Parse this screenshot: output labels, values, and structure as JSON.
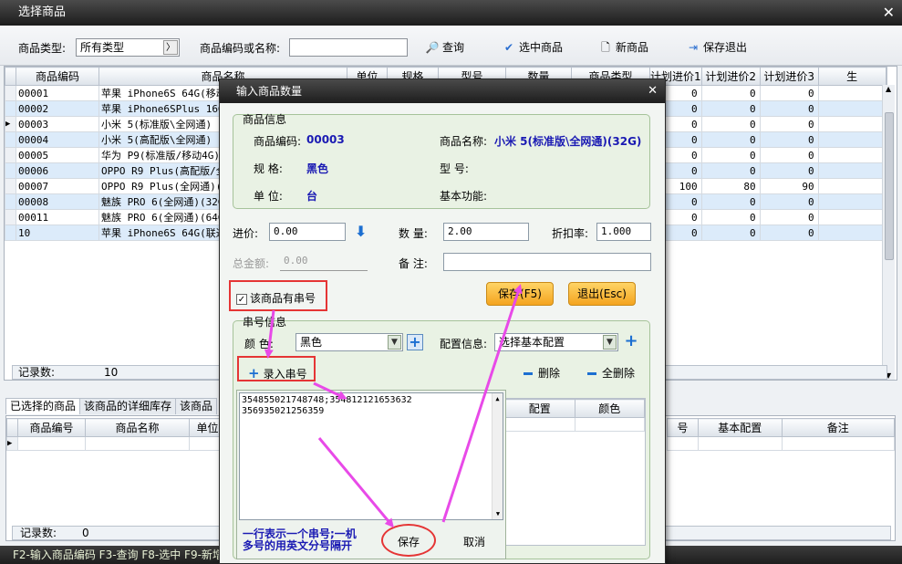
{
  "window": {
    "title": "选择商品"
  },
  "toolbar": {
    "type_label": "商品类型:",
    "type_value": "所有类型",
    "code_label": "商品编码或名称:",
    "search_placeholder": "",
    "query": "查询",
    "select": "选中商品",
    "new": "新商品",
    "save_exit": "保存退出"
  },
  "main_grid": {
    "columns": [
      "商品编码",
      "商品名称",
      "单位",
      "规格",
      "型号",
      "数量",
      "商品类型",
      "计划进价1",
      "计划进价2",
      "计划进价3",
      "生"
    ],
    "rows": [
      {
        "code": "00001",
        "name": "苹果 iPhone6S 64G(移动",
        "p1": "0",
        "p2": "0",
        "p3": "0"
      },
      {
        "code": "00002",
        "name": "苹果 iPhone6SPlus 16G",
        "p1": "0",
        "p2": "0",
        "p3": "0"
      },
      {
        "code": "00003",
        "name": "小米 5(标准版\\全网通)",
        "p1": "0",
        "p2": "0",
        "p3": "0"
      },
      {
        "code": "00004",
        "name": "小米 5(高配版\\全网通)",
        "p1": "0",
        "p2": "0",
        "p3": "0"
      },
      {
        "code": "00005",
        "name": "华为 P9(标准版/移动4G)",
        "p1": "0",
        "p2": "0",
        "p3": "0"
      },
      {
        "code": "00006",
        "name": "OPPO R9 Plus(高配版/全",
        "p1": "0",
        "p2": "0",
        "p3": "0"
      },
      {
        "code": "00007",
        "name": "OPPO R9 Plus(全网通)(6",
        "p1": "100",
        "p2": "80",
        "p3": "90"
      },
      {
        "code": "00008",
        "name": "魅族 PRO 6(全网通)(32G",
        "p1": "0",
        "p2": "0",
        "p3": "0"
      },
      {
        "code": "00011",
        "name": "魅族 PRO 6(全网通)(64G",
        "p1": "0",
        "p2": "0",
        "p3": "0"
      },
      {
        "code": "10",
        "name": "苹果 iPhone6S 64G(联通",
        "p1": "0",
        "p2": "0",
        "p3": "0"
      }
    ],
    "record_label": "记录数:",
    "record_count": "10"
  },
  "tabs": [
    "已选择的商品",
    "该商品的详细库存",
    "该商品"
  ],
  "sub_grid": {
    "columns_left": [
      "商品编号",
      "商品名称",
      "单位"
    ],
    "columns_right": [
      "号",
      "基本配置",
      "备注"
    ],
    "record_label": "记录数:",
    "record_count": "0"
  },
  "statusbar": "F2-输入商品编码 F3-查询 F8-选中 F9-新增",
  "dialog": {
    "title": "输入商品数量",
    "info_caption": "商品信息",
    "code_label": "商品编码:",
    "code_value": "00003",
    "name_label": "商品名称:",
    "name_value": "小米 5(标准版\\全网通)(32G)",
    "spec_label": "规  格:",
    "spec_value": "黑色",
    "model_label": "型  号:",
    "unit_label": "单  位:",
    "unit_value": "台",
    "func_label": "基本功能:",
    "price_label": "进价:",
    "price_value": "0.00",
    "qty_label": "数 量:",
    "qty_value": "2.00",
    "discount_label": "折扣率:",
    "discount_value": "1.000",
    "total_label": "总金额:",
    "total_value": "0.00",
    "remark_label": "备 注:",
    "has_serial_label": "该商品有串号",
    "save_btn": "保存(F5)",
    "exit_btn": "退出(Esc)",
    "serial_caption": "串号信息",
    "color_label": "颜  色:",
    "color_value": "黑色",
    "config_label": "配置信息:",
    "config_value": "选择基本配置",
    "add_serial": "录入串号",
    "delete": "删除",
    "delete_all": "全删除",
    "serial_lines": [
      "354855021748748;354812121653632",
      "356935021256359"
    ],
    "serial_cols": [
      "配置",
      "颜色"
    ],
    "note_line1": "一行表示一个串号;一机",
    "note_line2": "多号的用英文分号隔开",
    "popup_save": "保存",
    "popup_cancel": "取消"
  },
  "colors": {
    "accent": "#e53535",
    "arrow": "#e84ae8",
    "highlight_row": "#dcebfa",
    "value_text": "#1a1ab3"
  }
}
